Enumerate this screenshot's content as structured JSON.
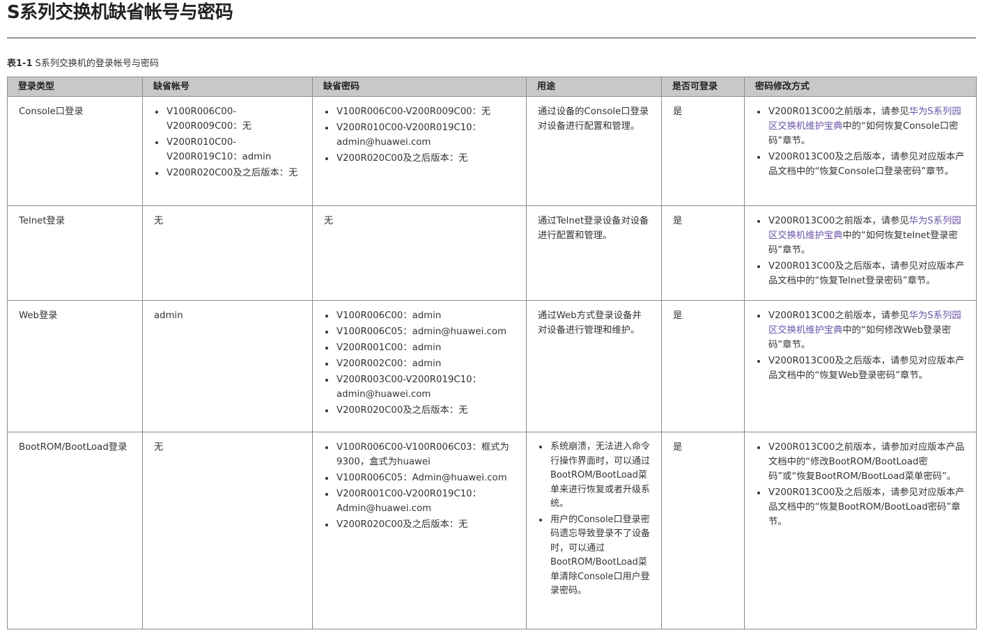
{
  "page": {
    "title": "S系列交换机缺省帐号与密码"
  },
  "caption": {
    "num": "表1-1",
    "text": "S系列交换机的登录帐号与密码"
  },
  "table": {
    "headers": [
      "登录类型",
      "缺省帐号",
      "缺省密码",
      "用途",
      "是否可登录",
      "密码修改方式"
    ],
    "rows": [
      {
        "type": "Console口登录",
        "account": [
          "V100R006C00-V200R009C00：无",
          "V200R010C00-V200R019C10：admin",
          "V200R020C00及之后版本：无"
        ],
        "password": [
          "V100R006C00-V200R009C00：无",
          "V200R010C00-V200R019C10：admin@huawei.com",
          "V200R020C00及之后版本：无"
        ],
        "usage": "通过设备的Console口登录对设备进行配置和管理。",
        "login": "是",
        "method": [
          {
            "pre": "V200R013C00之前版本，请参见",
            "link": "华为S系列园区交换机维护宝典",
            "post": "中的“如何恢复Console口密码”章节。"
          },
          {
            "pre": "V200R013C00及之后版本，请参见对应版本产品文档中的“恢复Console口登录密码”章节。"
          }
        ]
      },
      {
        "type": "Telnet登录",
        "account": "无",
        "password": "无",
        "usage": "通过Telnet登录设备对设备进行配置和管理。",
        "login": "是",
        "method": [
          {
            "pre": "V200R013C00之前版本，请参见",
            "link": "华为S系列园区交换机维护宝典",
            "post": "中的“如何恢复telnet登录密码”章节。"
          },
          {
            "pre": "V200R013C00及之后版本，请参见对应版本产品文档中的“恢复Telnet登录密码”章节。"
          }
        ]
      },
      {
        "type": "Web登录",
        "account": "admin",
        "password": [
          "V100R006C00：admin",
          "V100R006C05：admin@huawei.com",
          "V200R001C00：admin",
          "V200R002C00：admin",
          "V200R003C00-V200R019C10：admin@huawei.com",
          "V200R020C00及之后版本：无"
        ],
        "usage": "通过Web方式登录设备并对设备进行管理和维护。",
        "login": "是",
        "method": [
          {
            "pre": "V200R013C00之前版本，请参见",
            "link": "华为S系列园区交换机维护宝典",
            "post": "中的“如何修改Web登录密码”章节。"
          },
          {
            "pre": "V200R013C00及之后版本，请参见对应版本产品文档中的“恢复Web登录密码”章节。"
          }
        ]
      },
      {
        "type": "BootROM/BootLoad登录",
        "account": "无",
        "password": [
          "V100R006C00-V100R006C03：框式为9300，盒式为huawei",
          "V100R006C05：Admin@huawei.com",
          "V200R001C00-V200R019C10：Admin@huawei.com",
          "V200R020C00及之后版本：无"
        ],
        "usage": [
          "系统崩溃，无法进入命令行操作界面时，可以通过BootROM/BootLoad菜单来进行恢复或者升级系统。",
          "用户的Console口登录密码遗忘导致登录不了设备时，可以通过BootROM/BootLoad菜单清除Console口用户登录密码。"
        ],
        "login": "是",
        "method": [
          {
            "pre": "V200R013C00之前版本，请参加对应版本产品文档中的“修改BootROM/BootLoad密码”或“恢复BootROM/BootLoad菜单密码”。"
          },
          {
            "pre": "V200R013C00及之后版本，请参见对应版本产品文档中的“恢复BootROM/BootLoad密码”章节。"
          }
        ]
      }
    ]
  }
}
